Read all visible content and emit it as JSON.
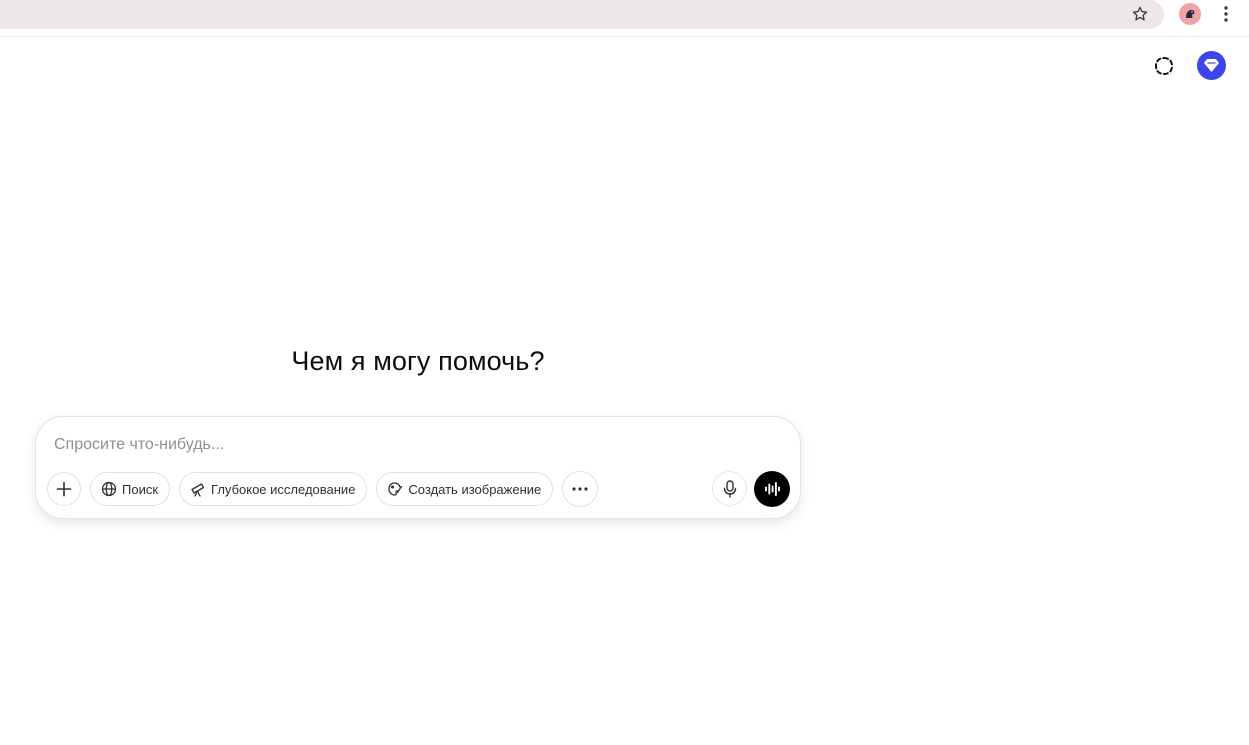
{
  "browser": {
    "icons": [
      "star-icon",
      "profile-avatar",
      "kebab-menu-icon"
    ]
  },
  "header": {
    "icons": [
      "temporary-chat-icon",
      "upgrade-plan-icon"
    ],
    "accent_color": "#3b45ee"
  },
  "main": {
    "heading": "Чем я могу помочь?"
  },
  "composer": {
    "placeholder": "Спросите что-нибудь...",
    "tools": {
      "search_label": "Поиск",
      "deep_research_label": "Глубокое исследование",
      "create_image_label": "Создать изображение"
    }
  }
}
